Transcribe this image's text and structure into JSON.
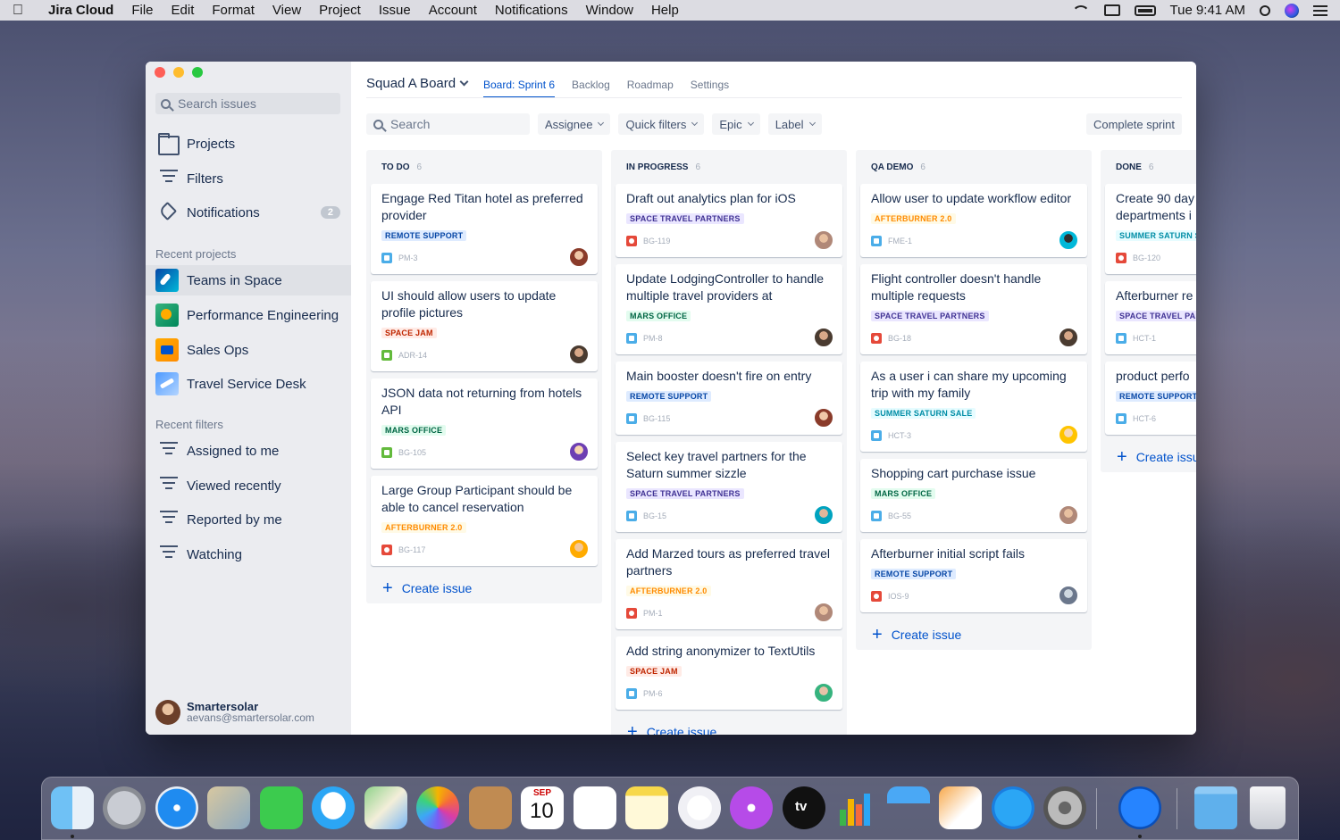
{
  "menubar": {
    "app_name": "Jira Cloud",
    "items": [
      "File",
      "Edit",
      "Format",
      "View",
      "Project",
      "Issue",
      "Account",
      "Notifications",
      "Window",
      "Help"
    ],
    "clock": "Tue 9:41 AM"
  },
  "sidebar": {
    "search_placeholder": "Search issues",
    "nav": [
      {
        "label": "Projects",
        "icon": "folder-icon"
      },
      {
        "label": "Filters",
        "icon": "filter-icon"
      },
      {
        "label": "Notifications",
        "icon": "bell-icon",
        "badge": "2"
      }
    ],
    "recent_projects_title": "Recent projects",
    "recent_projects": [
      {
        "label": "Teams in Space",
        "active": true
      },
      {
        "label": "Performance Engineering"
      },
      {
        "label": "Sales Ops"
      },
      {
        "label": "Travel Service Desk"
      }
    ],
    "recent_filters_title": "Recent filters",
    "recent_filters": [
      "Assigned to me",
      "Viewed recently",
      "Reported by me",
      "Watching"
    ],
    "user": {
      "name": "Smartersolar",
      "email": "aevans@smartersolar.com"
    }
  },
  "board": {
    "title": "Squad A Board",
    "tabs": [
      {
        "label": "Board: Sprint 6",
        "active": true
      },
      {
        "label": "Backlog"
      },
      {
        "label": "Roadmap"
      },
      {
        "label": "Settings"
      }
    ],
    "toolbar": {
      "search_placeholder": "Search",
      "filters": [
        "Assignee",
        "Quick filters",
        "Epic",
        "Label"
      ],
      "complete_label": "Complete sprint"
    },
    "create_label": "Create issue",
    "columns": [
      {
        "title": "TO DO",
        "count": "6",
        "cards": [
          {
            "summary": "Engage Red Titan hotel as preferred provider",
            "label": "REMOTE SUPPORT",
            "label_color": "blue",
            "type": "task",
            "key": "PM-3"
          },
          {
            "summary": "UI should allow users to update profile pictures",
            "label": "SPACE JAM",
            "label_color": "red",
            "type": "story",
            "key": "ADR-14"
          },
          {
            "summary": "JSON data not returning from hotels API",
            "label": "MARS OFFICE",
            "label_color": "green",
            "type": "story",
            "key": "BG-105"
          },
          {
            "summary": "Large Group Participant should be able to cancel reservation",
            "label": "AFTERBURNER 2.0",
            "label_color": "orange",
            "type": "bug",
            "key": "BG-117"
          }
        ]
      },
      {
        "title": "IN PROGRESS",
        "count": "6",
        "cards": [
          {
            "summary": "Draft out analytics plan for iOS",
            "label": "SPACE TRAVEL PARTNERS",
            "label_color": "purple",
            "type": "bug",
            "key": "BG-119"
          },
          {
            "summary": "Update LodgingController to handle multiple travel providers at",
            "label": "MARS OFFICE",
            "label_color": "green",
            "type": "task",
            "key": "PM-8"
          },
          {
            "summary": "Main booster doesn't fire on entry",
            "label": "REMOTE SUPPORT",
            "label_color": "blue",
            "type": "task",
            "key": "BG-115"
          },
          {
            "summary": "Select key travel partners for the Saturn summer sizzle",
            "label": "SPACE TRAVEL PARTNERS",
            "label_color": "purple",
            "type": "task",
            "key": "BG-15"
          },
          {
            "summary": "Add Marzed tours as preferred travel partners",
            "label": "AFTERBURNER 2.0",
            "label_color": "orange",
            "type": "bug",
            "key": "PM-1"
          },
          {
            "summary": "Add string anonymizer to TextUtils",
            "label": "SPACE JAM",
            "label_color": "red",
            "type": "task",
            "key": "PM-6"
          }
        ]
      },
      {
        "title": "QA DEMO",
        "count": "6",
        "cards": [
          {
            "summary": "Allow user to update workflow editor",
            "label": "AFTERBURNER 2.0",
            "label_color": "orange",
            "type": "task",
            "key": "FME-1"
          },
          {
            "summary": "Flight controller doesn't handle multiple requests",
            "label": "SPACE TRAVEL PARTNERS",
            "label_color": "purple",
            "type": "bug",
            "key": "BG-18"
          },
          {
            "summary": "As a user i can share my upcoming trip with my family",
            "label": "SUMMER SATURN SALE",
            "label_color": "teal",
            "type": "task",
            "key": "HCT-3"
          },
          {
            "summary": "Shopping cart purchase issue",
            "label": "MARS OFFICE",
            "label_color": "green",
            "type": "task",
            "key": "BG-55"
          },
          {
            "summary": "Afterburner initial script fails",
            "label": "REMOTE SUPPORT",
            "label_color": "blue",
            "type": "bug",
            "key": "IOS-9"
          }
        ]
      },
      {
        "title": "DONE",
        "count": "6",
        "cards": [
          {
            "summary": "Create 90 day departments i",
            "label": "SUMMER SATURN S",
            "label_color": "teal",
            "type": "bug",
            "key": "BG-120"
          },
          {
            "summary": "Afterburner re",
            "label": "SPACE TRAVEL PAR",
            "label_color": "purple",
            "type": "task",
            "key": "HCT-1"
          },
          {
            "summary": "product perfo",
            "label": "REMOTE SUPPORT",
            "label_color": "blue",
            "type": "task",
            "key": "HCT-6"
          }
        ]
      }
    ]
  },
  "dock": {
    "apps": [
      "finder",
      "launchpad",
      "safari",
      "mail",
      "facetime",
      "messages",
      "maps",
      "photos",
      "contacts",
      "calendar",
      "reminders",
      "notes",
      "music",
      "podcasts",
      "tv",
      "numbers",
      "keynote",
      "pages",
      "app-store",
      "system-preferences",
      "jira",
      "downloads-folder",
      "trash"
    ],
    "calendar_month": "SEP",
    "calendar_day": "10",
    "tv_label": "tv"
  }
}
